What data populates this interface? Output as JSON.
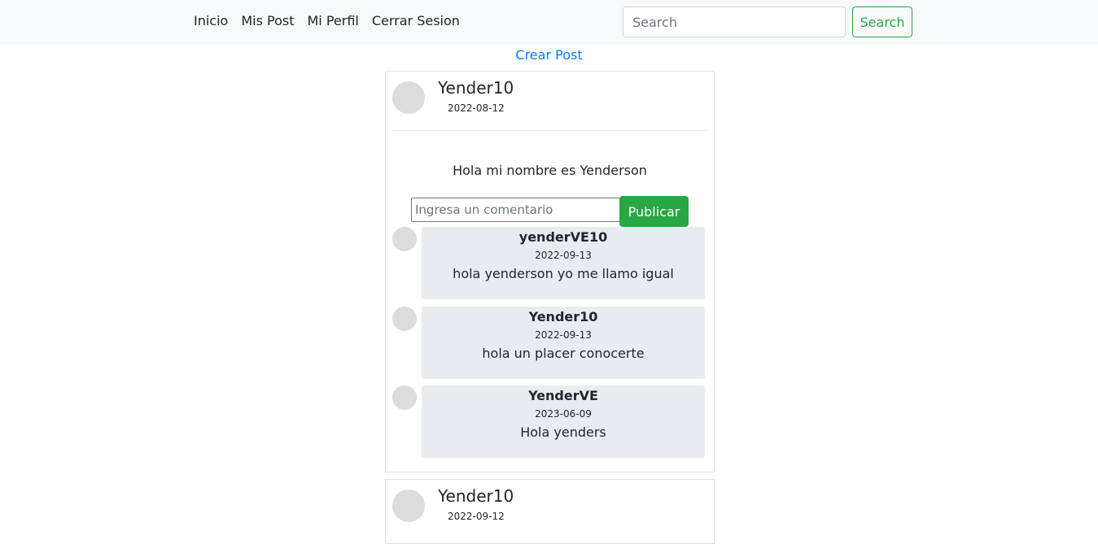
{
  "nav": {
    "links": [
      "Inicio",
      "Mis Post",
      "Mi Perfil",
      "Cerrar Sesion"
    ],
    "search_placeholder": "Search",
    "search_button": "Search"
  },
  "create_post_label": "Crear Post",
  "posts": [
    {
      "author": "Yender10",
      "date": "2022-08-12",
      "body": "Hola mi nombre es Yenderson",
      "comment_placeholder": "Ingresa un comentario",
      "publish_label": "Publicar",
      "comments": [
        {
          "author": "yenderVE10",
          "date": "2022-09-13",
          "text": "hola yenderson yo me llamo igual"
        },
        {
          "author": "Yender10",
          "date": "2022-09-13",
          "text": "hola un placer conocerte"
        },
        {
          "author": "YenderVE",
          "date": "2023-06-09",
          "text": "Hola yenders"
        }
      ]
    },
    {
      "author": "Yender10",
      "date": "2022-09-12"
    }
  ],
  "colors": {
    "navbar_bg": "#f8f9fa",
    "success": "#28a745",
    "link": "#007bff",
    "comment_bg": "#e9ecef",
    "avatar": "#dcdcdc"
  }
}
